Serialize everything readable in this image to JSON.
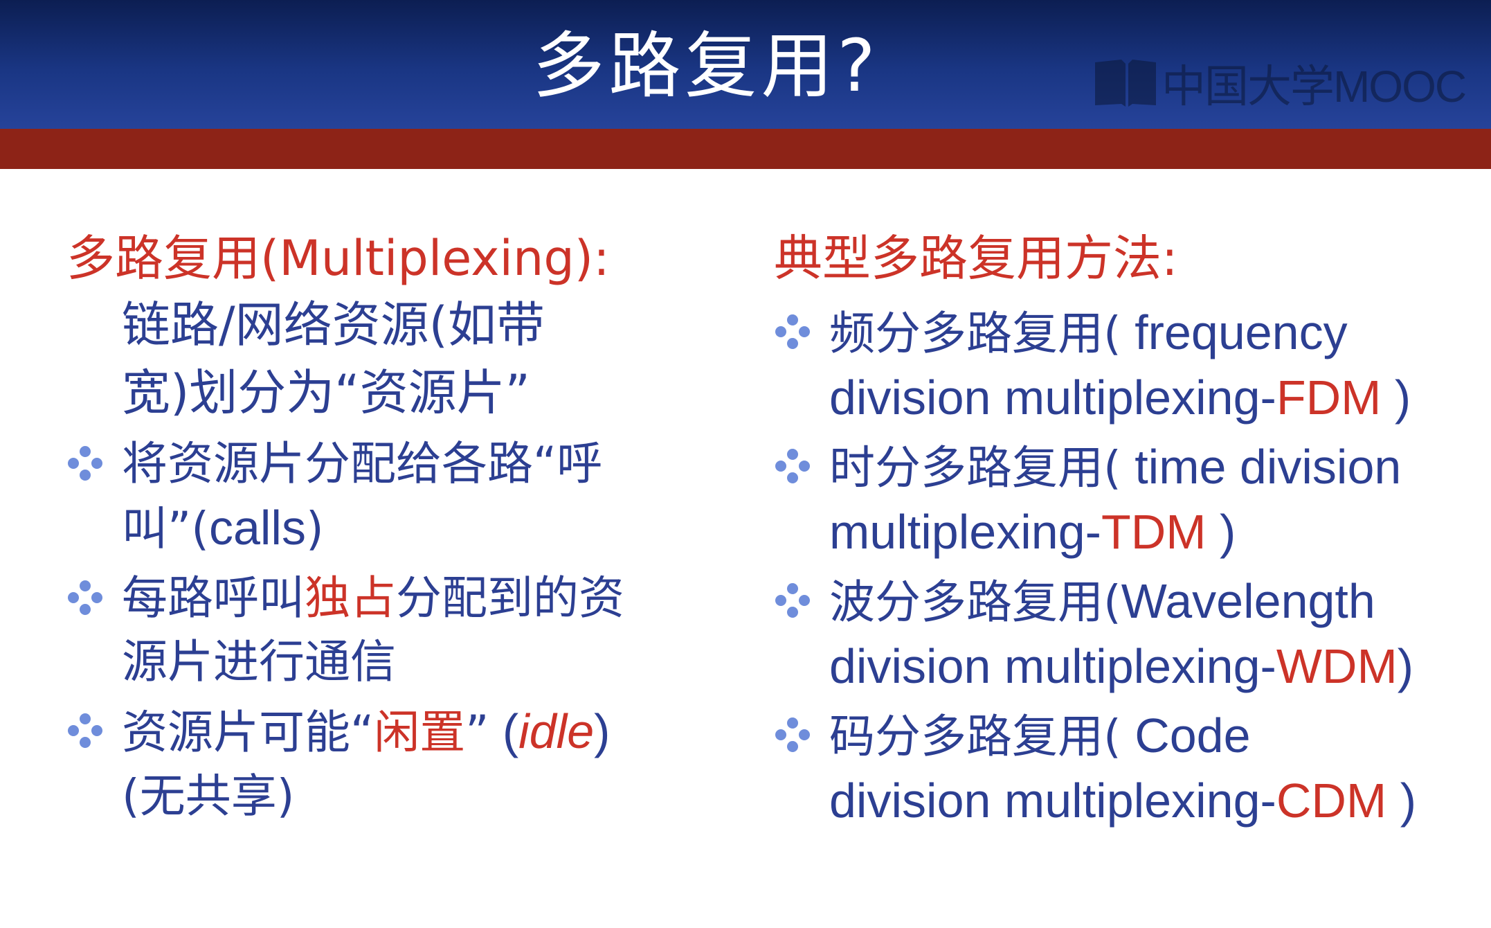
{
  "slide": {
    "title": "多路复用?",
    "logo_text": "中国大学MOOC",
    "colors": {
      "header_blue": "#1a3684",
      "accent_red_bar": "#8d2317",
      "text_blue": "#2c3f92",
      "text_red": "#cc3328"
    }
  },
  "left": {
    "heading": "多路复用(Multiplexing):",
    "desc_line1": "链路/网络资源(如带",
    "desc_line2": "宽)划分为“资源片”",
    "b1_line1": "将资源片分配给各路“呼",
    "b1_line2_a": "叫”(",
    "b1_line2_b": "calls",
    "b1_line2_c": ")",
    "b2_a": "每路呼叫",
    "b2_b": "独占",
    "b2_c": "分配到的资",
    "b2_line2": "源片进行通信",
    "b3_a": "资源片可能“",
    "b3_b": "闲置",
    "b3_c": "”",
    "b3_d": " (",
    "b3_e": "idle",
    "b3_f": ")",
    "b3_line2": "(无共享)"
  },
  "right": {
    "heading": "典型多路复用方法:",
    "items": [
      {
        "cn": "频分多路复用(",
        "en1": " frequency",
        "line2_a": "division multiplexing-",
        "line2_b": "FDM",
        "line2_c": " )"
      },
      {
        "cn": "时分多路复用(",
        "en1": " time division",
        "line2_a": "multiplexing-",
        "line2_b": "TDM",
        "line2_c": " )"
      },
      {
        "cn": "波分多路复用(",
        "en1": "Wavelength",
        "line2_a": "division multiplexing-",
        "line2_b": "WDM",
        "line2_c": ")"
      },
      {
        "cn": "码分多路复用(",
        "en1": " Code",
        "line2_a": "division multiplexing-",
        "line2_b": "CDM",
        "line2_c": " )"
      }
    ]
  },
  "icons": {
    "bullet": "diamond-dots-bullet-icon",
    "logo": "mooc-book-logo-icon"
  }
}
